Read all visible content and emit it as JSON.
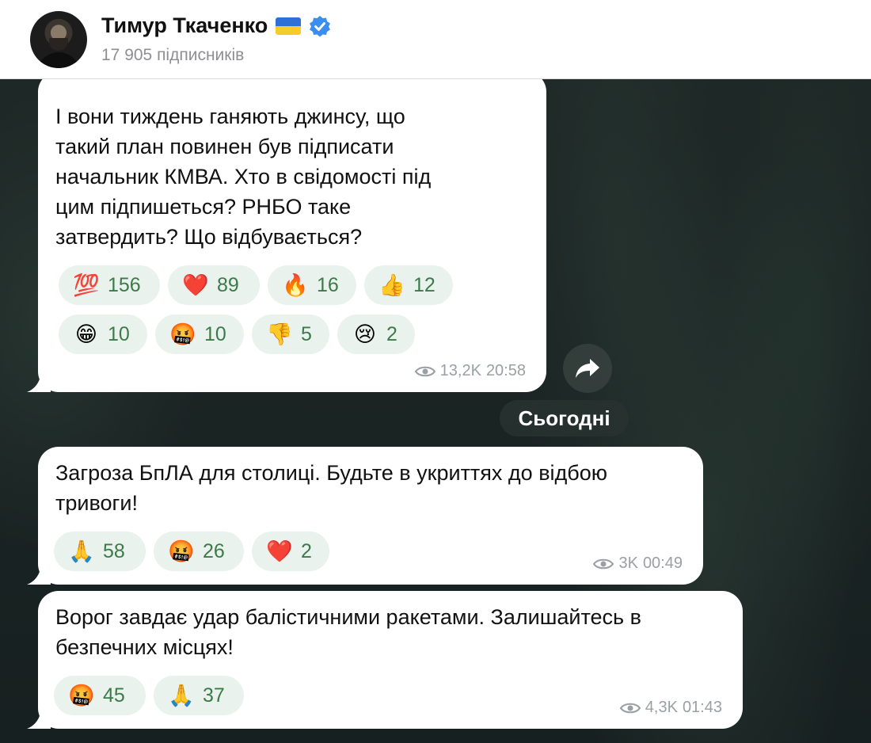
{
  "channel": {
    "name": "Тимур Ткаченко",
    "subscribers": "17 905 підписників"
  },
  "messages": [
    {
      "text": "І вони тиждень ганяють джинсу, що\nтакий план повинен був підписати\nначальник КМВА. Хто в свідомості під\nцим підпишеться? РНБО таке\nзатвердить? Що відбувається?",
      "reactions": [
        {
          "emoji": "💯",
          "icon": "hundred-points-icon",
          "count": "156"
        },
        {
          "emoji": "❤️",
          "icon": "red-heart-icon",
          "count": "89"
        },
        {
          "emoji": "🔥",
          "icon": "fire-icon",
          "count": "16"
        },
        {
          "emoji": "👍",
          "icon": "thumbs-up-icon",
          "count": "12"
        },
        {
          "emoji": "😁",
          "icon": "grinning-face-icon",
          "count": "10"
        },
        {
          "emoji": "🤬",
          "icon": "cursing-face-icon",
          "count": "10"
        },
        {
          "emoji": "👎",
          "icon": "thumbs-down-icon",
          "count": "5"
        },
        {
          "emoji": "😢",
          "icon": "crying-face-icon",
          "count": "2"
        }
      ],
      "views": "13,2K",
      "time": "20:58"
    },
    {
      "text": "Загроза БпЛА для столиці. Будьте в укриттях до відбою\nтривоги!",
      "reactions": [
        {
          "emoji": "🙏",
          "icon": "folded-hands-icon",
          "count": "58"
        },
        {
          "emoji": "🤬",
          "icon": "cursing-face-icon",
          "count": "26"
        },
        {
          "emoji": "❤️",
          "icon": "red-heart-icon",
          "count": "2"
        }
      ],
      "views": "3K",
      "time": "00:49"
    },
    {
      "text": "Ворог завдає удар балістичними ракетами. Залишайтесь в\nбезпечних місцях!",
      "reactions": [
        {
          "emoji": "🤬",
          "icon": "cursing-face-icon",
          "count": "45"
        },
        {
          "emoji": "🙏",
          "icon": "folded-hands-icon",
          "count": "37"
        }
      ],
      "views": "4,3K",
      "time": "01:43"
    }
  ],
  "date_separator": "Сьогодні",
  "colors": {
    "reaction_bg": "#e9f2ec",
    "reaction_count": "#3c7a4a",
    "verified": "#3a8ef0"
  }
}
